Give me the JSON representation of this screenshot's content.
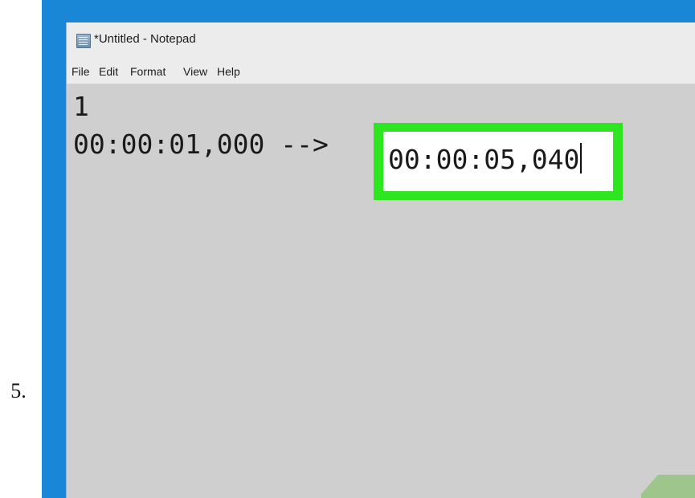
{
  "step": {
    "number": "5."
  },
  "window": {
    "title": "*Untitled - Notepad",
    "icon": "notepad-icon",
    "menu": [
      "File",
      "Edit",
      "Format",
      "View",
      "Help"
    ]
  },
  "editor": {
    "line1": "1",
    "line2_start": "00:00:01,000 -->",
    "line2_end": "00:00:05,040"
  },
  "colors": {
    "desktop": "#1a86d6",
    "editor_background": "#cfcfcf",
    "highlight": "#2ee61f",
    "decorative_shape": "#9ec58c"
  }
}
